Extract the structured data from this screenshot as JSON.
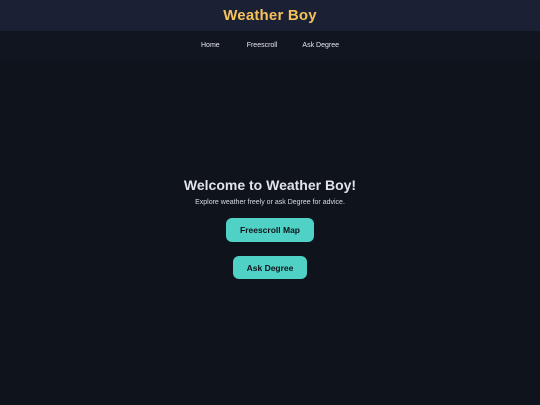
{
  "header": {
    "title": "Weather Boy"
  },
  "nav": {
    "items": [
      {
        "label": "Home"
      },
      {
        "label": "Freescroll"
      },
      {
        "label": "Ask Degree"
      }
    ]
  },
  "main": {
    "heading": "Welcome to Weather Boy!",
    "subtitle": "Explore weather freely or ask Degree for advice.",
    "buttons": {
      "freescroll_label": "Freescroll Map",
      "ask_label": "Ask Degree"
    }
  },
  "colors": {
    "background": "#0e131c",
    "header_bg": "#1b2135",
    "title": "#f6c15a",
    "accent": "#4fd1c5"
  }
}
